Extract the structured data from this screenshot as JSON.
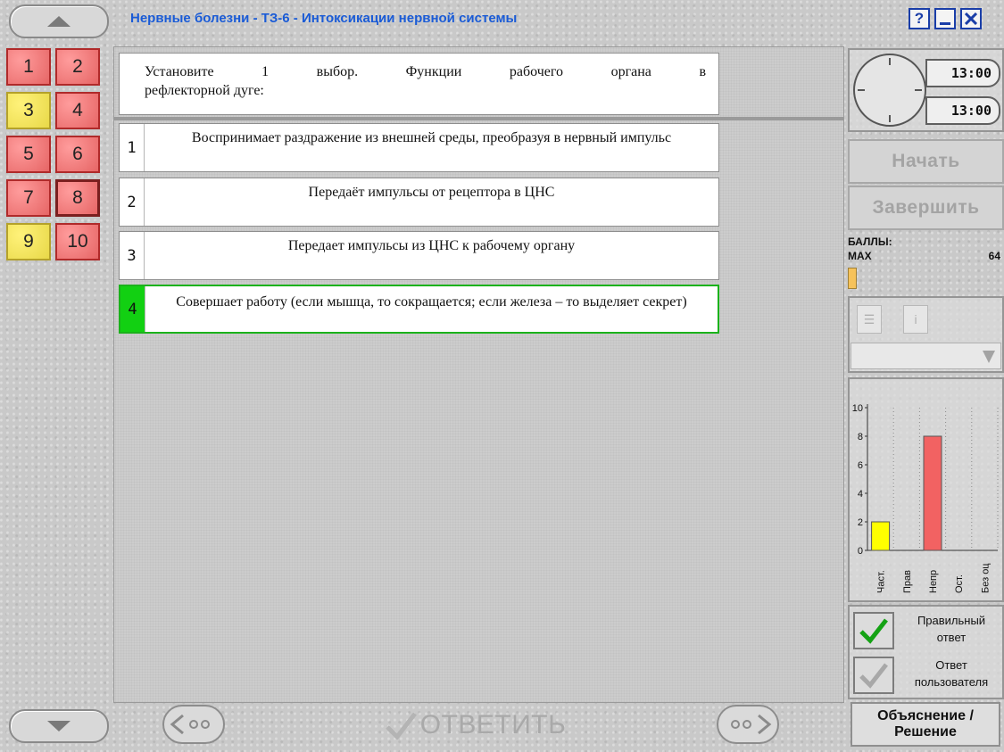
{
  "window": {
    "title": "Нервные болезни - ТЗ-6 - Интоксикации нервной системы",
    "help_label": "?"
  },
  "question_nav": {
    "items": [
      {
        "label": "1",
        "status": "wrong"
      },
      {
        "label": "2",
        "status": "wrong"
      },
      {
        "label": "3",
        "status": "partial"
      },
      {
        "label": "4",
        "status": "wrong"
      },
      {
        "label": "5",
        "status": "wrong"
      },
      {
        "label": "6",
        "status": "wrong"
      },
      {
        "label": "7",
        "status": "wrong"
      },
      {
        "label": "8",
        "status": "current"
      },
      {
        "label": "9",
        "status": "partial"
      },
      {
        "label": "10",
        "status": "wrong"
      }
    ]
  },
  "question": {
    "line1": "Установите 1 выбор. Функции рабочего органа в",
    "line2": "рефлекторной дуге:"
  },
  "options": [
    {
      "num": "1",
      "text": "Воспринимает раздражение из внешней среды, преобразуя в нервный импульс",
      "selected": false
    },
    {
      "num": "2",
      "text": "Передаёт импульсы от рецептора в ЦНС",
      "selected": false
    },
    {
      "num": "3",
      "text": "Передает импульсы из ЦНС к рабочему органу",
      "selected": false
    },
    {
      "num": "4",
      "text": "Совершает работу (если мышца, то сокращается; если железа – то выделяет секрет)",
      "selected": true
    }
  ],
  "bottom": {
    "answer_label": "ОТВЕТИТЬ",
    "explain_line1": "Объяснение /",
    "explain_line2": "Решение"
  },
  "timer": {
    "time_total": "13:00",
    "time_left": "13:00"
  },
  "controls": {
    "start_label": "Начать",
    "finish_label": "Завершить"
  },
  "score": {
    "label": "БАЛЛЫ:",
    "max_label": "MAX",
    "max_value": "64",
    "fraction": 0.0
  },
  "legend": {
    "correct_line1": "Правильный",
    "correct_line2": "ответ",
    "user_line1": "Ответ",
    "user_line2": "пользователя"
  },
  "colors": {
    "wrong": "#f07b7b",
    "partial": "#fff27a",
    "selected": "#12d012",
    "title": "#1a5bd6"
  },
  "chart_data": {
    "type": "bar",
    "categories": [
      "Част.",
      "Прав",
      "Непр",
      "Ост.",
      "Без оц"
    ],
    "values": [
      2,
      0,
      8,
      0,
      0
    ],
    "colors": [
      "#ffff00",
      "#00c800",
      "#f26262",
      "#999999",
      "#999999"
    ],
    "ylim": [
      0,
      10
    ],
    "yticks": [
      "0",
      "2",
      "4",
      "6",
      "8",
      "10"
    ],
    "grid": true
  }
}
